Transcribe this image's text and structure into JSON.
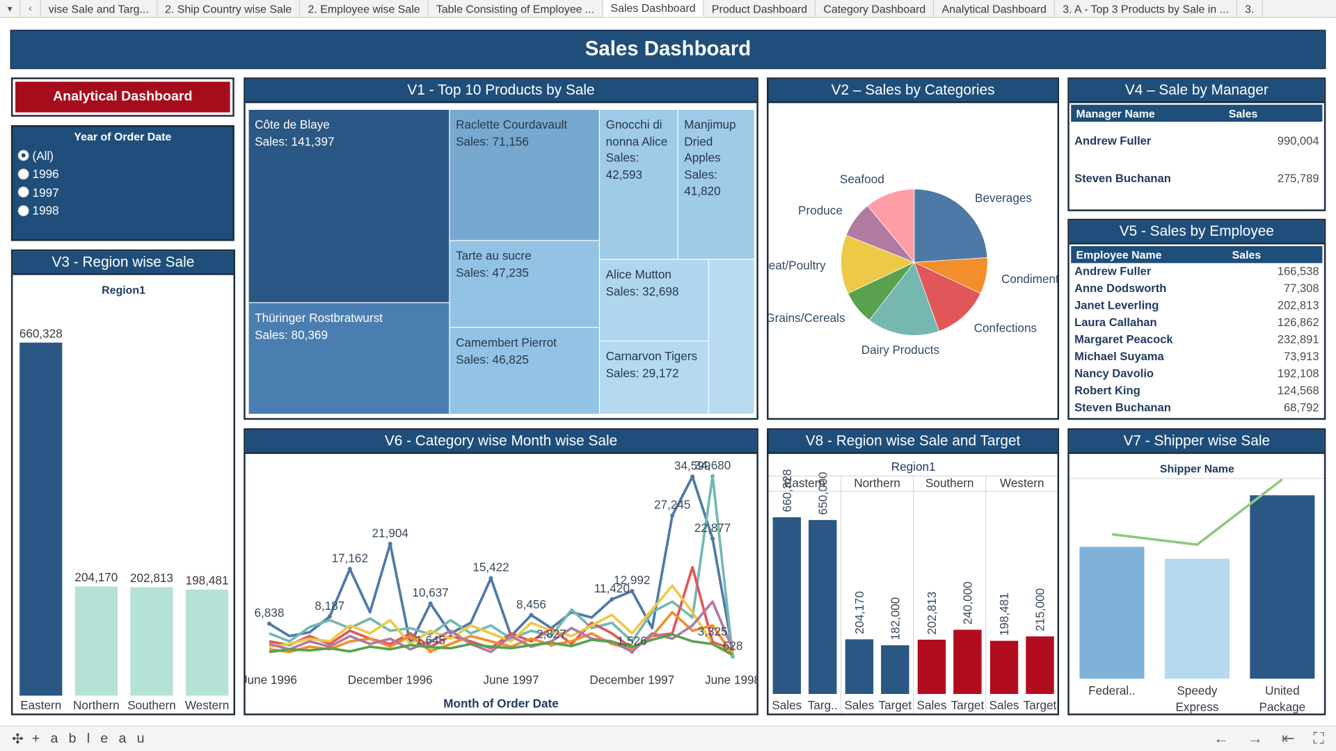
{
  "tabs": [
    {
      "label": "vise Sale and Targ...",
      "active": false
    },
    {
      "label": "2. Ship Country wise Sale",
      "active": false
    },
    {
      "label": "2. Employee wise Sale",
      "active": false
    },
    {
      "label": "Table Consisting of Employee ...",
      "active": false
    },
    {
      "label": "Sales Dashboard",
      "active": true
    },
    {
      "label": "Product Dashboard",
      "active": false
    },
    {
      "label": "Category Dashboard",
      "active": false
    },
    {
      "label": "Analytical Dashboard",
      "active": false
    },
    {
      "label": "3. A - Top 3 Products by Sale in ...",
      "active": false
    },
    {
      "label": "3.",
      "active": false
    }
  ],
  "title": "Sales Dashboard",
  "analytical_button": "Analytical Dashboard",
  "year_filter": {
    "title": "Year of Order Date",
    "options": [
      "(All)",
      "1996",
      "1997",
      "1998"
    ],
    "selected": "(All)"
  },
  "v1": {
    "title": "V1 - Top 10 Products by Sale",
    "tiles": [
      {
        "name": "Côte de Blaye",
        "value": "141,397",
        "color": "#2a5783"
      },
      {
        "name": "Thüringer Rostbratwurst",
        "value": "80,369",
        "color": "#4a7eb0"
      },
      {
        "name": "Raclette Courdavault",
        "value": "71,156",
        "color": "#77a9d0"
      },
      {
        "name": "Tarte au sucre",
        "value": "47,235",
        "color": "#93c3e4"
      },
      {
        "name": "Camembert Pierrot",
        "value": "46,825",
        "color": "#93c3e4"
      },
      {
        "name": "Gnocchi di nonna Alice",
        "value": "42,593",
        "color": "#9fcbe8"
      },
      {
        "name": "Manjimup Dried Apples",
        "value": "41,820",
        "color": "#9fcbe8"
      },
      {
        "name": "Alice Mutton",
        "value": "32,698",
        "color": "#b0d6ee"
      },
      {
        "name": "Carnarvon Tigers",
        "value": "29,172",
        "color": "#b5d9ef"
      },
      {
        "name": "",
        "value": "",
        "color": "#b8dbf1"
      }
    ],
    "sales_prefix": "Sales: "
  },
  "v2": {
    "title": "V2 – Sales by Categories",
    "chart_data": {
      "type": "pie",
      "slices": [
        {
          "label": "Beverages",
          "value": 24,
          "color": "#4e79a7"
        },
        {
          "label": "Condiments",
          "value": 8,
          "color": "#f28e2b"
        },
        {
          "label": "Confections",
          "value": 12.5,
          "color": "#e15759"
        },
        {
          "label": "Dairy Products",
          "value": 16,
          "color": "#76b7b2"
        },
        {
          "label": "Grains/Cereals",
          "value": 7.5,
          "color": "#59a14f"
        },
        {
          "label": "Meat/Poultry",
          "value": 13,
          "color": "#edc948"
        },
        {
          "label": "Produce",
          "value": 8,
          "color": "#b07aa1"
        },
        {
          "label": "Seafood",
          "value": 11,
          "color": "#ff9da7"
        }
      ]
    }
  },
  "v3": {
    "title": "V3 - Region wise Sale",
    "chart_data": {
      "type": "bar",
      "header": "Region1",
      "categories": [
        "Eastern",
        "Northern",
        "Southern",
        "Western"
      ],
      "values": [
        660328,
        204170,
        202813,
        198481
      ],
      "labels": [
        "660,328",
        "204,170",
        "202,813",
        "198,481"
      ],
      "colors": [
        "#2a5783",
        "#b5e2d6",
        "#b5e2d6",
        "#b5e2d6"
      ]
    }
  },
  "v4": {
    "title": "V4 – Sale by Manager",
    "col_name": "Manager Name",
    "col_sales": "Sales",
    "rows": [
      {
        "name": "Andrew Fuller",
        "sales": "990,004"
      },
      {
        "name": "Steven Buchanan",
        "sales": "275,789"
      }
    ]
  },
  "v5": {
    "title": "V5 - Sales by Employee",
    "col_name": "Employee Name",
    "col_sales": "Sales",
    "rows": [
      {
        "name": "Andrew Fuller",
        "sales": "166,538"
      },
      {
        "name": "Anne Dodsworth",
        "sales": "77,308"
      },
      {
        "name": "Janet Leverling",
        "sales": "202,813"
      },
      {
        "name": "Laura Callahan",
        "sales": "126,862"
      },
      {
        "name": "Margaret Peacock",
        "sales": "232,891"
      },
      {
        "name": "Michael Suyama",
        "sales": "73,913"
      },
      {
        "name": "Nancy Davolio",
        "sales": "192,108"
      },
      {
        "name": "Robert King",
        "sales": "124,568"
      },
      {
        "name": "Steven Buchanan",
        "sales": "68,792"
      }
    ]
  },
  "v6": {
    "title": "V6 - Category wise Month wise Sale",
    "chart_data": {
      "type": "line",
      "xlabel": "Month of Order Date",
      "x_ticks": [
        {
          "label": "June 1996",
          "index": 0
        },
        {
          "label": "December 1996",
          "index": 6
        },
        {
          "label": "June 1997",
          "index": 12
        },
        {
          "label": "December 1997",
          "index": 18
        },
        {
          "label": "June 1998",
          "index": 23
        }
      ],
      "ylim": [
        0,
        36000
      ],
      "series": [
        {
          "color": "#4e79a7",
          "values": [
            6838,
            4500,
            5200,
            8187,
            17162,
            9000,
            21904,
            3000,
            10637,
            5000,
            7000,
            15422,
            4500,
            8456,
            6000,
            9000,
            8000,
            11420,
            12992,
            6000,
            27245,
            34599,
            22877,
            1700
          ],
          "point_labels": [
            {
              "i": 0,
              "text": "6,838"
            },
            {
              "i": 3,
              "text": "8,187"
            },
            {
              "i": 4,
              "text": "17,162"
            },
            {
              "i": 6,
              "text": "21,904"
            },
            {
              "i": 8,
              "text": "10,637"
            },
            {
              "i": 11,
              "text": "15,422"
            },
            {
              "i": 13,
              "text": "8,456"
            },
            {
              "i": 17,
              "text": "11,420"
            },
            {
              "i": 18,
              "text": "12,992"
            },
            {
              "i": 20,
              "text": "27,245"
            },
            {
              "i": 21,
              "text": "34,599"
            },
            {
              "i": 22,
              "text": "22,877"
            }
          ]
        },
        {
          "color": "#76b7b2",
          "values": [
            5000,
            3500,
            6200,
            7500,
            6000,
            7800,
            5500,
            6000,
            4800,
            7500,
            5000,
            6500,
            4000,
            5500,
            4500,
            9500,
            6000,
            7000,
            3500,
            9000,
            11000,
            8000,
            34680,
            628
          ],
          "point_labels": [
            {
              "i": 22,
              "text": "34,680"
            },
            {
              "i": 23,
              "text": "628"
            }
          ]
        },
        {
          "color": "#e15759",
          "values": [
            3500,
            2800,
            4500,
            3000,
            5500,
            4000,
            3000,
            5000,
            2500,
            4500,
            3500,
            2200,
            5000,
            3500,
            6000,
            3000,
            7000,
            5000,
            2200,
            4500,
            5000,
            17500,
            3325,
            2000
          ],
          "point_labels": [
            {
              "i": 22,
              "text": "3,325"
            }
          ]
        },
        {
          "color": "#edc948",
          "values": [
            2500,
            3000,
            4000,
            3500,
            6500,
            5000,
            7500,
            3000,
            5500,
            4000,
            6500,
            5000,
            3500,
            7000,
            5500,
            4500,
            6500,
            8500,
            5000,
            9500,
            14000,
            9000,
            3000,
            1500
          ]
        },
        {
          "color": "#f28e2b",
          "values": [
            2000,
            1500,
            2500,
            2000,
            3500,
            4000,
            2500,
            4500,
            1645,
            3000,
            4500,
            3500,
            2500,
            4000,
            2827,
            3500,
            5000,
            3000,
            2000,
            4500,
            9000,
            5500,
            6500,
            1000
          ],
          "point_labels": [
            {
              "i": 8,
              "text": "1,645"
            },
            {
              "i": 14,
              "text": "2,827"
            }
          ]
        },
        {
          "color": "#b07aa1",
          "values": [
            3000,
            2000,
            3500,
            2500,
            4500,
            3000,
            4000,
            2000,
            3500,
            5500,
            3000,
            1500,
            4500,
            2500,
            3500,
            6000,
            4000,
            3500,
            1526,
            5000,
            4000,
            6500,
            11000,
            2000
          ],
          "point_labels": [
            {
              "i": 18,
              "text": "1,526"
            }
          ]
        },
        {
          "color": "#59a14f",
          "values": [
            1500,
            2000,
            1800,
            2200,
            1600,
            2500,
            2000,
            2800,
            2400,
            2200,
            3000,
            2500,
            2200,
            2800,
            3200,
            2600,
            3800,
            3400,
            2500,
            3800,
            4800,
            3500,
            3000,
            900
          ]
        }
      ]
    }
  },
  "v8": {
    "title": "V8 - Region wise Sale and Target",
    "chart_data": {
      "type": "bar",
      "header": "Region1",
      "regions": [
        "Eastern",
        "Northern",
        "Southern",
        "Western"
      ],
      "measures": [
        "Sales",
        "Target"
      ],
      "measure_labels": [
        [
          "Sales",
          "Targ.."
        ],
        [
          "Sales",
          "Target"
        ],
        [
          "Sales",
          "Target"
        ],
        [
          "Sales",
          "Target"
        ]
      ],
      "values": [
        [
          660328,
          650000
        ],
        [
          204170,
          182000
        ],
        [
          202813,
          240000
        ],
        [
          198481,
          215000
        ]
      ],
      "labels": [
        [
          "660,328",
          "650,000"
        ],
        [
          "204,170",
          "182,000"
        ],
        [
          "202,813",
          "240,000"
        ],
        [
          "198,481",
          "215,000"
        ]
      ],
      "colors": [
        "#2a5783",
        "#2a5783",
        "#b20d1f",
        "#b20d1f"
      ]
    }
  },
  "v7": {
    "title": "V7 - Shipper wise Sale",
    "chart_data": {
      "type": "bar",
      "header": "Shipper Name",
      "categories": [
        "Federal..",
        "Speedy Express",
        "United Package"
      ],
      "category_lines": [
        [
          "Federal.."
        ],
        [
          "Speedy",
          "Express"
        ],
        [
          "United",
          "Package"
        ]
      ],
      "values": [
        383405,
        348840,
        533547
      ],
      "target_line": [
        420000,
        390000,
        580000
      ],
      "colors": [
        "#7fb2d9",
        "#b5d9ef",
        "#2a5783"
      ],
      "line_color": "#8fc97e"
    }
  },
  "footer": {
    "logo": "+ a b l e a u",
    "controls": [
      "←",
      "→",
      "⇤",
      "⛶"
    ]
  }
}
